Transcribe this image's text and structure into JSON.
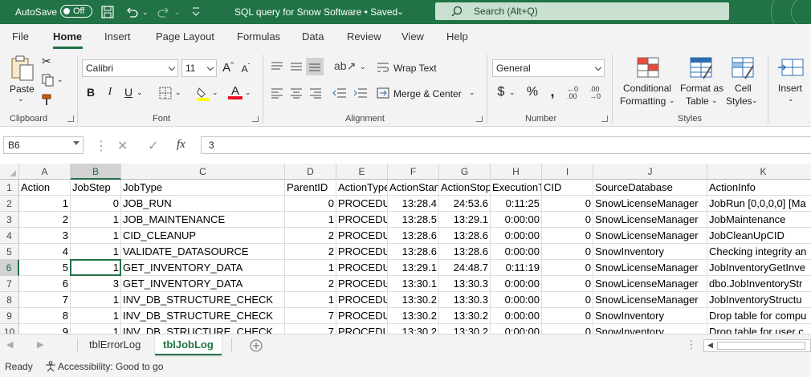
{
  "titlebar": {
    "autosave_label": "AutoSave",
    "autosave_state": "Off",
    "doc_title": "SQL query for Snow Software • Saved",
    "search_placeholder": "Search (Alt+Q)",
    "bg_color": "#217346"
  },
  "menu_tabs": [
    "File",
    "Home",
    "Insert",
    "Page Layout",
    "Formulas",
    "Data",
    "Review",
    "View",
    "Help"
  ],
  "active_tab": "Home",
  "ribbon": {
    "clipboard": {
      "paste_label": "Paste",
      "group_label": "Clipboard"
    },
    "font": {
      "font_name": "Calibri",
      "font_size": "11",
      "group_label": "Font"
    },
    "alignment": {
      "wrap_text": "Wrap Text",
      "merge_center": "Merge & Center",
      "group_label": "Alignment"
    },
    "number": {
      "format": "General",
      "group_label": "Number"
    },
    "styles": {
      "conditional_1": "Conditional",
      "conditional_2": "Formatting",
      "format_as_1": "Format as",
      "format_as_2": "Table",
      "cell_styles_1": "Cell",
      "cell_styles_2": "Styles",
      "group_label": "Styles"
    },
    "cells": {
      "insert_label": "Insert"
    }
  },
  "formula_bar": {
    "name_box": "B6",
    "fx": "fx",
    "value": "3"
  },
  "grid": {
    "column_letters": [
      "A",
      "B",
      "C",
      "D",
      "E",
      "F",
      "G",
      "H",
      "I",
      "J",
      "K"
    ],
    "row_numbers": [
      "1",
      "2",
      "3",
      "4",
      "5",
      "6",
      "7",
      "8",
      "9",
      "10"
    ],
    "header_row": [
      "Action",
      "JobStep",
      "JobType",
      "ParentID",
      "ActionType",
      "ActionStart",
      "ActionStop",
      "ExecutionTime",
      "CID",
      "SourceDatabase",
      "ActionInfo"
    ],
    "rows": [
      [
        "1",
        "0",
        "JOB_RUN",
        "0",
        "PROCEDURE",
        "13:28.4",
        "24:53.6",
        "0:11:25",
        "0",
        "SnowLicenseManager",
        "JobRun [0,0,0,0] [Ma"
      ],
      [
        "2",
        "1",
        "JOB_MAINTENANCE",
        "1",
        "PROCEDURE",
        "13:28.5",
        "13:29.1",
        "0:00:00",
        "0",
        "SnowLicenseManager",
        "JobMaintenance"
      ],
      [
        "3",
        "1",
        "CID_CLEANUP",
        "2",
        "PROCEDURE",
        "13:28.6",
        "13:28.6",
        "0:00:00",
        "0",
        "SnowLicenseManager",
        "JobCleanUpCID"
      ],
      [
        "4",
        "1",
        "VALIDATE_DATASOURCE",
        "2",
        "PROCEDURE",
        "13:28.6",
        "13:28.6",
        "0:00:00",
        "0",
        "SnowInventory",
        "Checking integrity an"
      ],
      [
        "5",
        "1",
        "GET_INVENTORY_DATA",
        "1",
        "PROCEDURE",
        "13:29.1",
        "24:48.7",
        "0:11:19",
        "0",
        "SnowLicenseManager",
        "JobInventoryGetInve"
      ],
      [
        "6",
        "3",
        "GET_INVENTORY_DATA",
        "2",
        "PROCEDURE",
        "13:30.1",
        "13:30.3",
        "0:00:00",
        "0",
        "SnowLicenseManager",
        "dbo.JobInventoryStr"
      ],
      [
        "7",
        "1",
        "INV_DB_STRUCTURE_CHECK",
        "1",
        "PROCEDURE",
        "13:30.2",
        "13:30.3",
        "0:00:00",
        "0",
        "SnowLicenseManager",
        "JobInventoryStructu"
      ],
      [
        "8",
        "1",
        "INV_DB_STRUCTURE_CHECK",
        "7",
        "PROCEDURE",
        "13:30.2",
        "13:30.2",
        "0:00:00",
        "0",
        "SnowInventory",
        "Drop table for compu"
      ],
      [
        "9",
        "1",
        "INV_DB_STRUCTURE_CHECK",
        "7",
        "PROCEDURE",
        "13:30.2",
        "13:30.2",
        "0:00:00",
        "0",
        "SnowInventory",
        "Drop table for user c"
      ]
    ]
  },
  "sheets": [
    "tblErrorLog",
    "tblJobLog"
  ],
  "active_sheet": "tblJobLog",
  "status": {
    "ready": "Ready",
    "accessibility": "Accessibility: Good to go"
  },
  "accent_color": "#217346"
}
